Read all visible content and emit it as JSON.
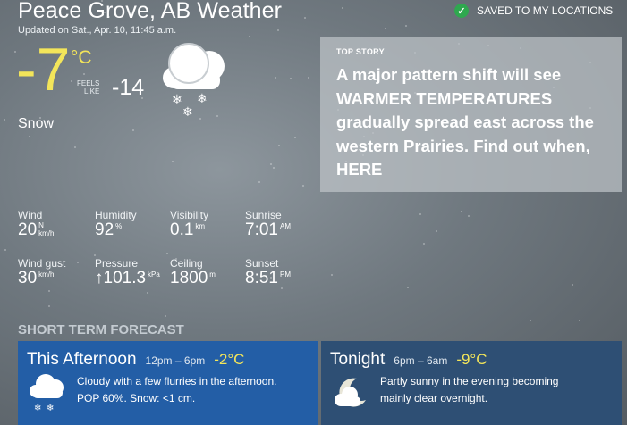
{
  "header": {
    "title": "Peace Grove, AB Weather",
    "updated": "Updated on Sat., Apr. 10, 11:45 a.m.",
    "saved_label": "SAVED TO MY LOCATIONS"
  },
  "current": {
    "temp": "-7",
    "unit": "°C",
    "feels_label_1": "FEELS",
    "feels_label_2": "LIKE",
    "feels_value": "-14",
    "condition": "Snow",
    "icon": "snow-cloud-icon"
  },
  "top_story": {
    "label": "TOP STORY",
    "text": "A major pattern shift will see WARMER TEMPERATURES gradually spread east across the western Prairies. Find out when, HERE"
  },
  "metrics": {
    "wind": {
      "label": "Wind",
      "value": "20",
      "dir": "N",
      "unit": "km/h"
    },
    "humidity": {
      "label": "Humidity",
      "value": "92",
      "unit": "%"
    },
    "visibility": {
      "label": "Visibility",
      "value": "0.1",
      "unit": "km"
    },
    "sunrise": {
      "label": "Sunrise",
      "value": "7:01",
      "unit": "AM"
    },
    "wind_gust": {
      "label": "Wind gust",
      "value": "30",
      "unit": "km/h"
    },
    "pressure": {
      "label": "Pressure",
      "value": "↑101.3",
      "unit": "kPa"
    },
    "ceiling": {
      "label": "Ceiling",
      "value": "1800",
      "unit": "m"
    },
    "sunset": {
      "label": "Sunset",
      "value": "8:51",
      "unit": "PM"
    }
  },
  "short_term": {
    "heading": "SHORT TERM FORECAST",
    "periods": [
      {
        "title": "This Afternoon",
        "time": "12pm – 6pm",
        "temp": "-2°C",
        "line1": "Cloudy with a few flurries in the afternoon.",
        "line2": "POP 60%. Snow: <1 cm.",
        "icon": "flurries-cloud-icon",
        "color": "#235ea6"
      },
      {
        "title": "Tonight",
        "time": "6pm – 6am",
        "temp": "-9°C",
        "line1": "Partly sunny in the evening becoming",
        "line2": "mainly clear overnight.",
        "icon": "partly-cloudy-night-icon",
        "color": "#2e4f74"
      }
    ]
  },
  "colors": {
    "accent_temp": "#f3e55a",
    "saved_check": "#2fa84f"
  }
}
